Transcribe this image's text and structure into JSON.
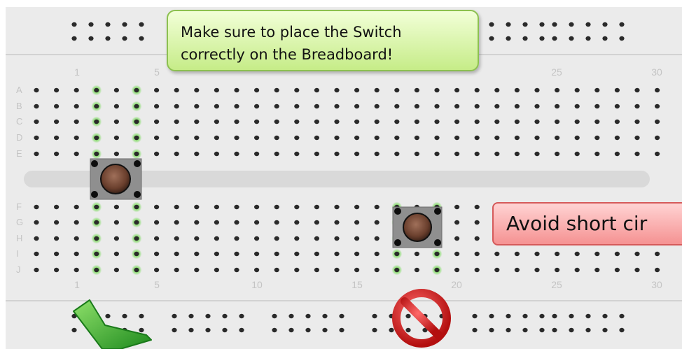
{
  "board": {
    "row_letters_top": [
      "A",
      "B",
      "C",
      "D",
      "E"
    ],
    "row_letters_bottom": [
      "F",
      "G",
      "H",
      "I",
      "J"
    ],
    "column_labels": [
      "1",
      "5",
      "10",
      "15",
      "20",
      "25",
      "30"
    ]
  },
  "callouts": {
    "placement_line1": "Make sure to place the Switch",
    "placement_line2": "correctly on the Breadboard!",
    "short_circuit": "Avoid short cir"
  },
  "colors": {
    "board": "#ebebeb",
    "hole": "#2a2a2a",
    "highlight": "#5fd63a",
    "label": "#c4c4c4",
    "check": "#3cb83c",
    "forbidden": "#d51818"
  },
  "icons": {
    "correct": "checkmark-icon",
    "wrong": "no-entry-icon"
  }
}
